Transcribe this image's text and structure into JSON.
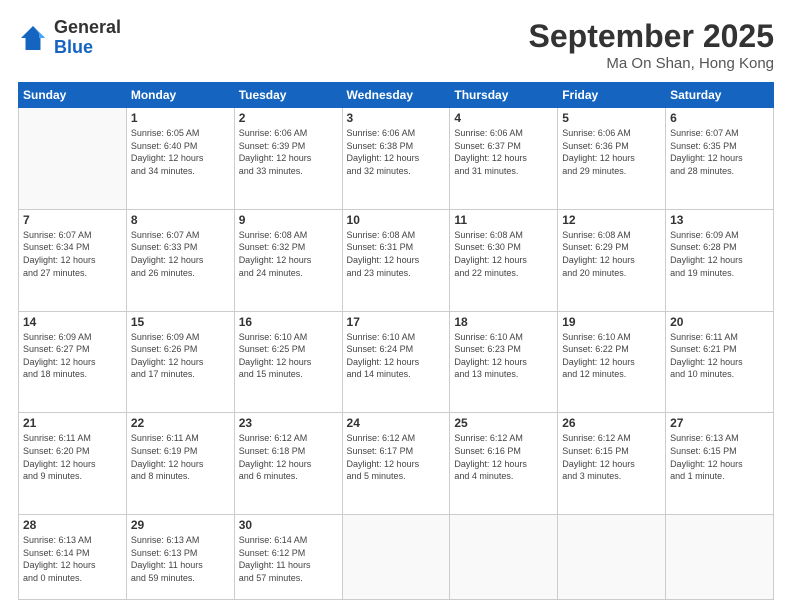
{
  "header": {
    "logo_general": "General",
    "logo_blue": "Blue",
    "month_title": "September 2025",
    "location": "Ma On Shan, Hong Kong"
  },
  "weekdays": [
    "Sunday",
    "Monday",
    "Tuesday",
    "Wednesday",
    "Thursday",
    "Friday",
    "Saturday"
  ],
  "weeks": [
    [
      {
        "day": "",
        "info": ""
      },
      {
        "day": "1",
        "info": "Sunrise: 6:05 AM\nSunset: 6:40 PM\nDaylight: 12 hours\nand 34 minutes."
      },
      {
        "day": "2",
        "info": "Sunrise: 6:06 AM\nSunset: 6:39 PM\nDaylight: 12 hours\nand 33 minutes."
      },
      {
        "day": "3",
        "info": "Sunrise: 6:06 AM\nSunset: 6:38 PM\nDaylight: 12 hours\nand 32 minutes."
      },
      {
        "day": "4",
        "info": "Sunrise: 6:06 AM\nSunset: 6:37 PM\nDaylight: 12 hours\nand 31 minutes."
      },
      {
        "day": "5",
        "info": "Sunrise: 6:06 AM\nSunset: 6:36 PM\nDaylight: 12 hours\nand 29 minutes."
      },
      {
        "day": "6",
        "info": "Sunrise: 6:07 AM\nSunset: 6:35 PM\nDaylight: 12 hours\nand 28 minutes."
      }
    ],
    [
      {
        "day": "7",
        "info": "Sunrise: 6:07 AM\nSunset: 6:34 PM\nDaylight: 12 hours\nand 27 minutes."
      },
      {
        "day": "8",
        "info": "Sunrise: 6:07 AM\nSunset: 6:33 PM\nDaylight: 12 hours\nand 26 minutes."
      },
      {
        "day": "9",
        "info": "Sunrise: 6:08 AM\nSunset: 6:32 PM\nDaylight: 12 hours\nand 24 minutes."
      },
      {
        "day": "10",
        "info": "Sunrise: 6:08 AM\nSunset: 6:31 PM\nDaylight: 12 hours\nand 23 minutes."
      },
      {
        "day": "11",
        "info": "Sunrise: 6:08 AM\nSunset: 6:30 PM\nDaylight: 12 hours\nand 22 minutes."
      },
      {
        "day": "12",
        "info": "Sunrise: 6:08 AM\nSunset: 6:29 PM\nDaylight: 12 hours\nand 20 minutes."
      },
      {
        "day": "13",
        "info": "Sunrise: 6:09 AM\nSunset: 6:28 PM\nDaylight: 12 hours\nand 19 minutes."
      }
    ],
    [
      {
        "day": "14",
        "info": "Sunrise: 6:09 AM\nSunset: 6:27 PM\nDaylight: 12 hours\nand 18 minutes."
      },
      {
        "day": "15",
        "info": "Sunrise: 6:09 AM\nSunset: 6:26 PM\nDaylight: 12 hours\nand 17 minutes."
      },
      {
        "day": "16",
        "info": "Sunrise: 6:10 AM\nSunset: 6:25 PM\nDaylight: 12 hours\nand 15 minutes."
      },
      {
        "day": "17",
        "info": "Sunrise: 6:10 AM\nSunset: 6:24 PM\nDaylight: 12 hours\nand 14 minutes."
      },
      {
        "day": "18",
        "info": "Sunrise: 6:10 AM\nSunset: 6:23 PM\nDaylight: 12 hours\nand 13 minutes."
      },
      {
        "day": "19",
        "info": "Sunrise: 6:10 AM\nSunset: 6:22 PM\nDaylight: 12 hours\nand 12 minutes."
      },
      {
        "day": "20",
        "info": "Sunrise: 6:11 AM\nSunset: 6:21 PM\nDaylight: 12 hours\nand 10 minutes."
      }
    ],
    [
      {
        "day": "21",
        "info": "Sunrise: 6:11 AM\nSunset: 6:20 PM\nDaylight: 12 hours\nand 9 minutes."
      },
      {
        "day": "22",
        "info": "Sunrise: 6:11 AM\nSunset: 6:19 PM\nDaylight: 12 hours\nand 8 minutes."
      },
      {
        "day": "23",
        "info": "Sunrise: 6:12 AM\nSunset: 6:18 PM\nDaylight: 12 hours\nand 6 minutes."
      },
      {
        "day": "24",
        "info": "Sunrise: 6:12 AM\nSunset: 6:17 PM\nDaylight: 12 hours\nand 5 minutes."
      },
      {
        "day": "25",
        "info": "Sunrise: 6:12 AM\nSunset: 6:16 PM\nDaylight: 12 hours\nand 4 minutes."
      },
      {
        "day": "26",
        "info": "Sunrise: 6:12 AM\nSunset: 6:15 PM\nDaylight: 12 hours\nand 3 minutes."
      },
      {
        "day": "27",
        "info": "Sunrise: 6:13 AM\nSunset: 6:15 PM\nDaylight: 12 hours\nand 1 minute."
      }
    ],
    [
      {
        "day": "28",
        "info": "Sunrise: 6:13 AM\nSunset: 6:14 PM\nDaylight: 12 hours\nand 0 minutes."
      },
      {
        "day": "29",
        "info": "Sunrise: 6:13 AM\nSunset: 6:13 PM\nDaylight: 11 hours\nand 59 minutes."
      },
      {
        "day": "30",
        "info": "Sunrise: 6:14 AM\nSunset: 6:12 PM\nDaylight: 11 hours\nand 57 minutes."
      },
      {
        "day": "",
        "info": ""
      },
      {
        "day": "",
        "info": ""
      },
      {
        "day": "",
        "info": ""
      },
      {
        "day": "",
        "info": ""
      }
    ]
  ]
}
